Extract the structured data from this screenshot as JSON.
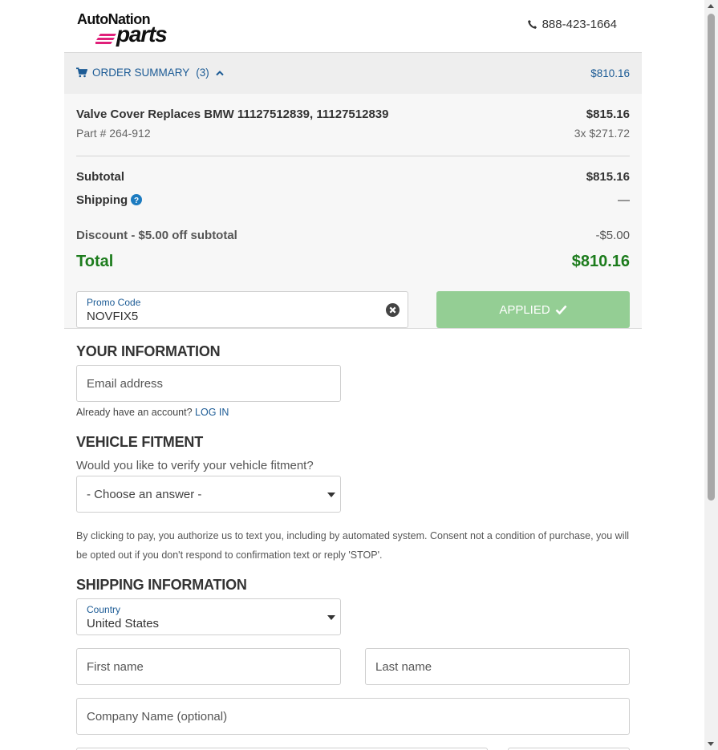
{
  "brand": {
    "logo_top": "AutoNation",
    "logo_bottom": "parts",
    "phone": "888-423-1664"
  },
  "order_summary": {
    "label": "ORDER SUMMARY",
    "count": "(3)",
    "total": "$810.16",
    "item": {
      "name": "Valve Cover Replaces BMW 11127512839, 11127512839",
      "part_number": "Part # 264-912",
      "price": "$815.16",
      "qty_price": "3x $271.72"
    },
    "subtotal_label": "Subtotal",
    "subtotal_value": "$815.16",
    "shipping_label": "Shipping",
    "shipping_value": "—",
    "discount_label": "Discount - $5.00 off subtotal",
    "discount_value": "-$5.00",
    "total_label": "Total",
    "total_value": "$810.16",
    "promo_label": "Promo Code",
    "promo_value": "NOVFIX5",
    "applied_label": "APPLIED"
  },
  "your_information": {
    "title": "YOUR INFORMATION",
    "email_placeholder": "Email address",
    "account_prompt": "Already have an account?",
    "login_link": "LOG IN"
  },
  "vehicle_fitment": {
    "title": "VEHICLE FITMENT",
    "question": "Would you like to verify your vehicle fitment?",
    "select_value": "- Choose an answer -"
  },
  "consent_text": "By clicking to pay, you authorize us to text you, including by automated system. Consent not a condition of purchase, you will be opted out if you don't respond to confirmation text or reply 'STOP'.",
  "shipping_information": {
    "title": "SHIPPING INFORMATION",
    "country_label": "Country",
    "country_value": "United States",
    "first_name_placeholder": "First name",
    "last_name_placeholder": "Last name",
    "company_placeholder": "Company Name (optional)"
  },
  "colors": {
    "link_blue": "#1c5b95",
    "total_green": "#1d7c1d",
    "applied_green": "#94ce94",
    "logo_stripe_pink": "#e0207a"
  }
}
